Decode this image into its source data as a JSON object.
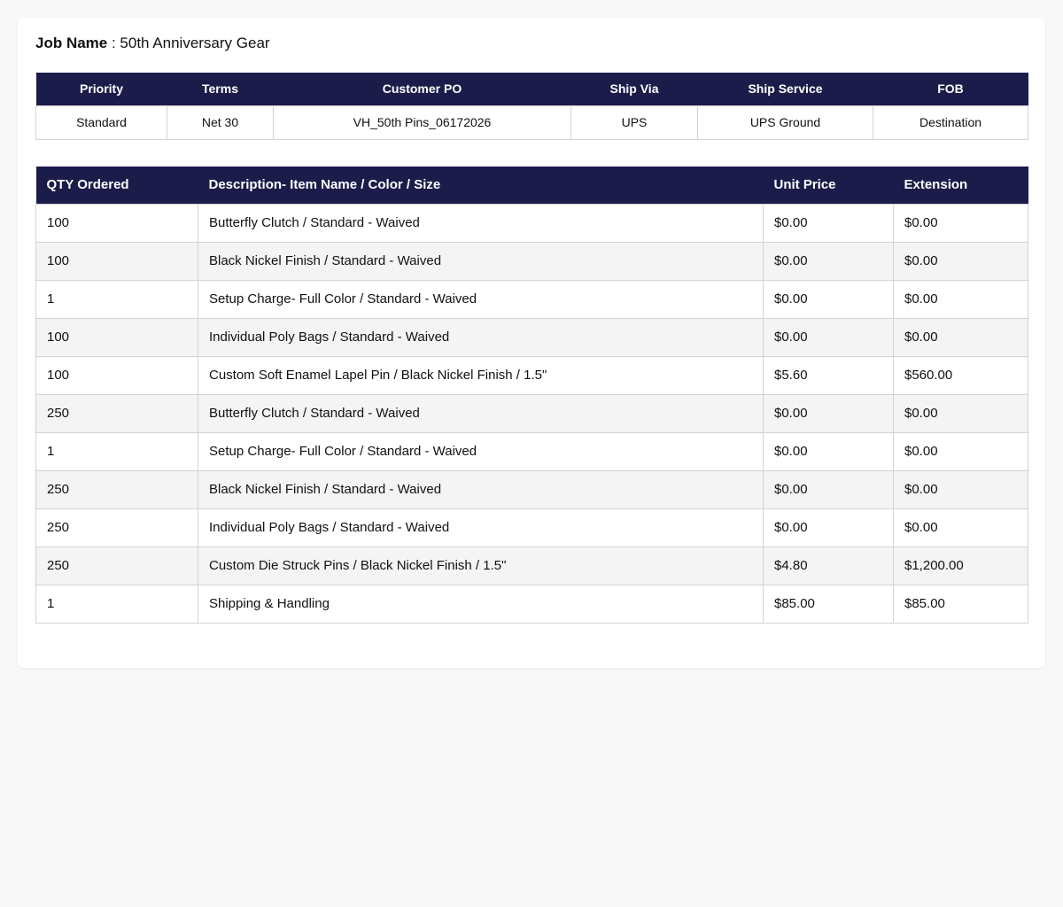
{
  "job": {
    "label": "Job Name",
    "separator": " : ",
    "value": "50th Anniversary Gear"
  },
  "info": {
    "headers": [
      "Priority",
      "Terms",
      "Customer PO",
      "Ship Via",
      "Ship Service",
      "FOB"
    ],
    "values": [
      "Standard",
      "Net 30",
      "VH_50th Pins_06172026",
      "UPS",
      "UPS Ground",
      "Destination"
    ]
  },
  "items": {
    "headers": [
      "QTY Ordered",
      "Description- Item Name / Color / Size",
      "Unit Price",
      "Extension"
    ],
    "rows": [
      [
        "100",
        "Butterfly Clutch / Standard - Waived",
        "$0.00",
        "$0.00"
      ],
      [
        "100",
        "Black Nickel Finish / Standard - Waived",
        "$0.00",
        "$0.00"
      ],
      [
        "1",
        "Setup Charge- Full Color / Standard - Waived",
        "$0.00",
        "$0.00"
      ],
      [
        "100",
        "Individual Poly Bags / Standard - Waived",
        "$0.00",
        "$0.00"
      ],
      [
        "100",
        "Custom Soft Enamel Lapel Pin / Black Nickel Finish / 1.5\"",
        "$5.60",
        "$560.00"
      ],
      [
        "250",
        "Butterfly Clutch / Standard - Waived",
        "$0.00",
        "$0.00"
      ],
      [
        "1",
        "Setup Charge- Full Color / Standard - Waived",
        "$0.00",
        "$0.00"
      ],
      [
        "250",
        "Black Nickel Finish / Standard - Waived",
        "$0.00",
        "$0.00"
      ],
      [
        "250",
        "Individual Poly Bags / Standard - Waived",
        "$0.00",
        "$0.00"
      ],
      [
        "250",
        "Custom Die Struck Pins / Black Nickel Finish / 1.5\"",
        "$4.80",
        "$1,200.00"
      ],
      [
        "1",
        "Shipping & Handling",
        "$85.00",
        "$85.00"
      ]
    ]
  },
  "colors": {
    "header_bg": "#1c1c4a",
    "stripe_bg": "#f4f4f4"
  }
}
